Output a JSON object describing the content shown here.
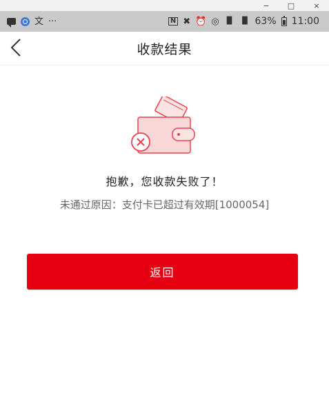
{
  "window": {
    "minimize": "−",
    "maximize": "□",
    "close": "×"
  },
  "status_bar": {
    "left_icons": [
      "message-icon",
      "app-icon",
      "text-icon",
      "more-icon"
    ],
    "text_glyph": "文",
    "more": "···",
    "nfc": "N",
    "mute": "✖",
    "alarm": "⏰",
    "wifi": "◎",
    "signal_1": "▐▌",
    "signal_2": "▐▌",
    "battery_percent": "63%",
    "time": "11:00"
  },
  "app_bar": {
    "title": "收款结果",
    "back_icon": "chevron-left-icon"
  },
  "result": {
    "illustration_icon": "wallet-error-icon",
    "heading": "抱歉，您收款失败了！",
    "reason": "未通过原因：支付卡已超过有效期[1000054]"
  },
  "actions": {
    "return_label": "返回"
  },
  "colors": {
    "accent": "#e60012",
    "illustration_line": "#e8434b",
    "illustration_fill": "#f9d6d8"
  }
}
